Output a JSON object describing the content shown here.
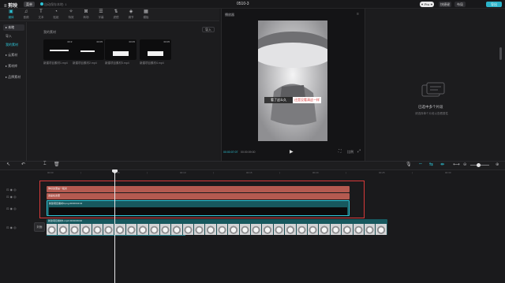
{
  "app": {
    "logo": "≡ 剪映",
    "menu": "菜单",
    "status": "自动保存本地: 1",
    "title": "0510-3",
    "pro": "✦ Pro ✦",
    "upgrade": "快捷键",
    "layout": "布局",
    "export": "导出"
  },
  "toolbar": [
    {
      "icon": "▣",
      "label": "媒体"
    },
    {
      "icon": "♫",
      "label": "音频"
    },
    {
      "icon": "T",
      "label": "文本"
    },
    {
      "icon": "◔",
      "label": "贴纸"
    },
    {
      "icon": "✧",
      "label": "特效"
    },
    {
      "icon": "⊠",
      "label": "转场"
    },
    {
      "icon": "☰",
      "label": "字幕"
    },
    {
      "icon": "⇅",
      "label": "滤镜"
    },
    {
      "icon": "◈",
      "label": "调节"
    },
    {
      "icon": "▦",
      "label": "模板"
    }
  ],
  "leftnav": {
    "items": [
      "▸ 本地",
      "导入",
      "我的素材",
      "▸ 云素材",
      "▸ 素材库",
      "▸ 品牌素材"
    ]
  },
  "media": {
    "header": "我的素材",
    "import": "导入",
    "items": [
      {
        "caption": "新建项目素材1.mp4",
        "duration": "00:27"
      },
      {
        "caption": "新建项目素材2.mp4",
        "duration": "00:05"
      },
      {
        "caption": "新建项目素材3.mp4",
        "duration": "00:05"
      },
      {
        "caption": "新建项目素材4.mp4",
        "duration": "00:05"
      }
    ]
  },
  "player": {
    "title": "播放器",
    "caption_left": "看了这么久",
    "caption_right": "还是没看清这一样",
    "time_current": "00:00:07:07",
    "time_total": "00:00:09:00",
    "ratio": "比例"
  },
  "rightpanel": {
    "empty_title": "已选中多个片段",
    "empty_sub": "请选择单个片段以查看属性"
  },
  "timeline": {
    "ruler": [
      "00:00",
      "|",
      "00:05",
      "|",
      "00:10",
      "|",
      "00:15",
      "|",
      "00:20",
      "|",
      "00:25",
      "|",
      "00:30"
    ],
    "clip1": "你好这里是一段文",
    "clip2": "这是在这里",
    "clip3": "新建项目素材3.png 00:00:04:13",
    "main_label": "新建项目素材1.mp4  00:00:09:00",
    "cover": "封面"
  },
  "colors": {
    "accent": "#2ec4d6",
    "text_clip": "#b45a50",
    "video_clip": "#17585e",
    "selection": "#d83a3a"
  }
}
